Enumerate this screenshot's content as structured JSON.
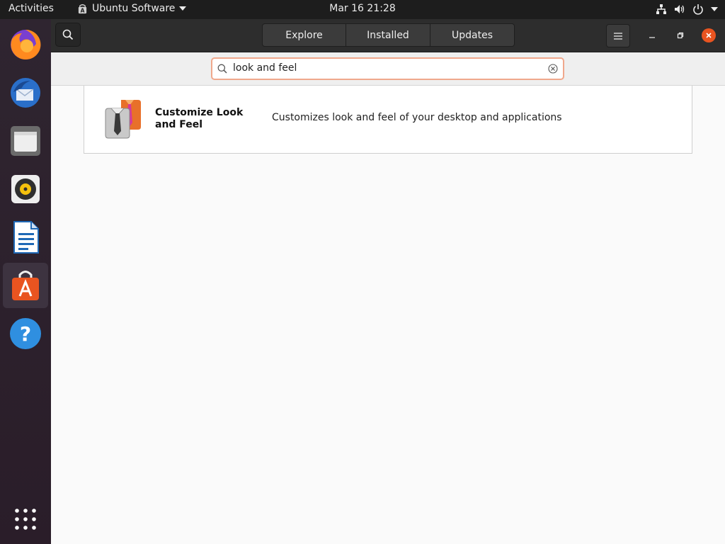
{
  "topbar": {
    "activities": "Activities",
    "app_name": "Ubuntu Software",
    "clock": "Mar 16  21:28"
  },
  "dock": {
    "items": [
      "Firefox",
      "Thunderbird Mail",
      "Files",
      "Rhythmbox",
      "LibreOffice Writer",
      "Ubuntu Software",
      "Help",
      "Show Applications"
    ],
    "active": "Ubuntu Software"
  },
  "header": {
    "tabs": [
      "Explore",
      "Installed",
      "Updates"
    ]
  },
  "search": {
    "query": "look and feel"
  },
  "results": [
    {
      "name": "Customize Look and Feel",
      "summary": "Customizes look and feel of your desktop and applications"
    }
  ],
  "colors": {
    "accent": "#e95420",
    "topbar": "#1d1d1d",
    "headerbar": "#2d2d2d"
  }
}
